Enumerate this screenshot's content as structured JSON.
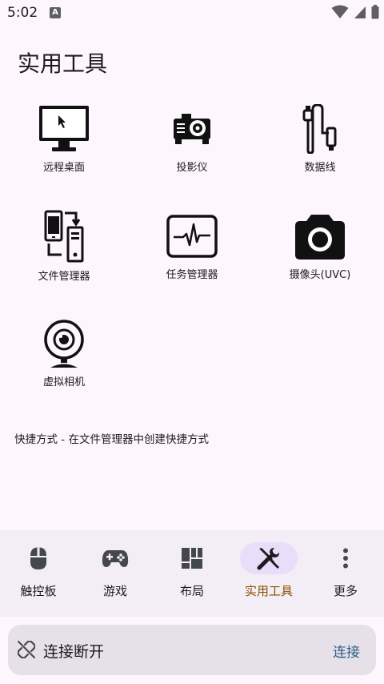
{
  "status_bar": {
    "time": "5:02",
    "notification_badge": "A",
    "icons": [
      "wifi-icon",
      "cellular-signal-icon",
      "battery-icon"
    ]
  },
  "page": {
    "title": "实用工具"
  },
  "tools": [
    {
      "label": "远程桌面",
      "icon": "monitor-icon"
    },
    {
      "label": "投影仪",
      "icon": "projector-icon"
    },
    {
      "label": "数据线",
      "icon": "usb-cable-icon"
    },
    {
      "label": "文件管理器",
      "icon": "file-transfer-icon"
    },
    {
      "label": "任务管理器",
      "icon": "activity-monitor-icon"
    },
    {
      "label": "摄像头(UVC)",
      "icon": "camera-icon"
    },
    {
      "label": "虚拟相机",
      "icon": "webcam-icon"
    }
  ],
  "hint": "快捷方式 - 在文件管理器中创建快捷方式",
  "bottom_nav": {
    "items": [
      {
        "label": "触控板",
        "icon": "mouse-icon"
      },
      {
        "label": "游戏",
        "icon": "gamepad-icon"
      },
      {
        "label": "布局",
        "icon": "layout-icon"
      },
      {
        "label": "实用工具",
        "icon": "tools-icon",
        "active": true
      },
      {
        "label": "更多",
        "icon": "more-vert-icon"
      }
    ]
  },
  "connection": {
    "status": "连接断开",
    "action_label": "连接",
    "icon": "link-off-icon"
  },
  "colors": {
    "background": "#fdf7fd",
    "nav_background": "#f3edf6",
    "nav_active_pill": "#e9def9",
    "nav_active_label": "#8a5100",
    "connect_action": "#2a5f8a",
    "connection_bar": "#e6e0e8"
  }
}
